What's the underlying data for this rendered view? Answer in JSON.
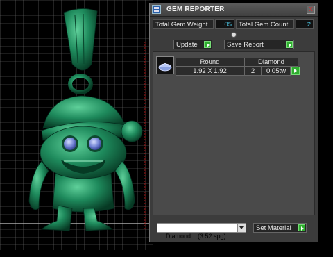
{
  "panel": {
    "title": "GEM REPORTER",
    "close_label": "x",
    "total_gem_weight_label": "Total Gem Weight",
    "total_gem_weight_value": ".05",
    "total_gem_count_label": "Total Gem Count",
    "total_gem_count_value": "2",
    "update_label": "Update",
    "save_report_label": "Save Report"
  },
  "gem_table": {
    "headers": [
      "Round",
      "Diamond"
    ],
    "rows": [
      {
        "size": "1.92 X 1.92",
        "count": "2",
        "weight": "0.05tw"
      }
    ]
  },
  "material": {
    "selected": "Diamond    (3.52 spg)",
    "set_label": "Set Material"
  },
  "colors": {
    "panel_bg": "#3c3c3c",
    "value_text": "#4dc8e8",
    "go_button": "#2fae2f",
    "model": "#1e8a5c"
  },
  "icons": [
    "app-icon",
    "close-icon",
    "slider-thumb",
    "gem-thumbnail",
    "go-arrow-icon",
    "chevron-down-icon"
  ]
}
